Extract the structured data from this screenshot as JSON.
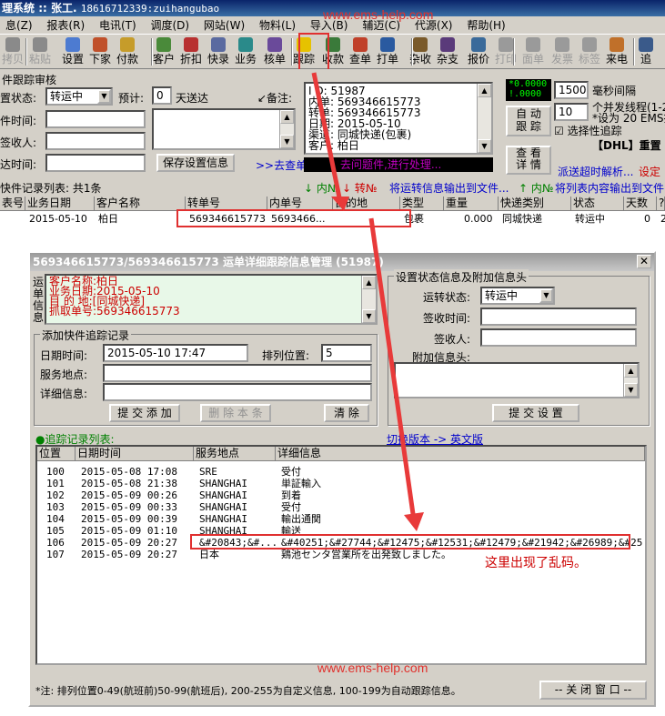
{
  "window": {
    "title": "理系统",
    "separator": "::",
    "user": "张工.",
    "account": "18616712339:zuihangubao"
  },
  "watermark": {
    "top": "www.ems-help.com",
    "bottom": "www.ems-help.com"
  },
  "menu": [
    "息(Z)",
    "报表(R)",
    "电讯(T)",
    "调度(D)",
    "网站(W)",
    "物料(L)",
    "导入(B)",
    "辅迈(C)",
    "代源(X)",
    "帮助(H)"
  ],
  "toolbar": {
    "items": [
      {
        "label": "拷贝",
        "disabled": true
      },
      {
        "label": "粘贴",
        "disabled": true
      },
      {
        "label": "设置",
        "disabled": false
      },
      {
        "label": "下家",
        "disabled": false
      },
      {
        "label": "付款",
        "disabled": false
      },
      {
        "label": "客户",
        "disabled": false
      },
      {
        "label": "折扣",
        "disabled": false
      },
      {
        "label": "快录",
        "disabled": false
      },
      {
        "label": "业务",
        "disabled": false
      },
      {
        "label": "核单",
        "disabled": false
      },
      {
        "label": "跟踪",
        "disabled": false
      },
      {
        "label": "收款",
        "disabled": false
      },
      {
        "label": "查单",
        "disabled": false
      },
      {
        "label": "打单",
        "disabled": false
      },
      {
        "label": "杂收",
        "disabled": false
      },
      {
        "label": "杂支",
        "disabled": false
      },
      {
        "label": "报价",
        "disabled": false
      },
      {
        "label": "打印",
        "disabled": true
      },
      {
        "label": "面单",
        "disabled": true
      },
      {
        "label": "发票",
        "disabled": true
      },
      {
        "label": "标签",
        "disabled": true
      },
      {
        "label": "来电",
        "disabled": false
      },
      {
        "label": "追",
        "disabled": false
      }
    ]
  },
  "tracking": {
    "section_title": "件跟踪审核",
    "status_label": "置状态:",
    "status_value": "转运中",
    "estimate_label": "预计:",
    "estimate_value": "0",
    "days_label": "天送达",
    "note_label": "↙备注:",
    "time_label": "件时间:",
    "signer_label": "签收人:",
    "arrive_label": "达时间:",
    "save_button": "保存设置信息",
    "goto_button": ">>去查单",
    "info_lines": [
      "I D: 51987",
      "内单: 569346615773",
      "转单: 569346615773",
      "日期: 2015-05-10",
      "渠道: 同城快递(包裹)",
      "客户: 柏日"
    ],
    "info_status": "去问题件,进行处理...",
    "clock1": "*0.0000",
    "clock2": "!.0000",
    "interval_value": "1500",
    "interval_label": "毫秒间隔",
    "threads_value": "10",
    "threads_label": "个并发线程(1-2",
    "threads_note": "*设为 20 EMS批",
    "auto_button": "自 动\n跟 踪",
    "selective_label": "选择性追踪",
    "dhl_label": "【DHL】重置",
    "view_button": "查 看\n详 情",
    "timeout_link": "派送超时解析...",
    "timeout_link2": "设定",
    "down_inner": "↓ 内№",
    "down_trans": "↓ 转№",
    "export_link": "将运转信息输出到文件...",
    "up_inner": "↑ 内№",
    "export_link2": "将列表内容输出到文件"
  },
  "list": {
    "count_label": "快件记录列表: 共1条",
    "headers": [
      "表号",
      "业务日期",
      "客户名称",
      "转单号",
      "内单号",
      "目的地",
      "类型",
      "重量",
      "快递类别",
      "状态",
      "天数",
      "?"
    ],
    "rows": [
      {
        "no": "",
        "date": "2015-05-10",
        "customer": "柏日",
        "trans": "569346615773",
        "inner": "5693466...",
        "dest": "",
        "type": "包裹",
        "weight": "0.000",
        "category": "同城快递",
        "status": "转运中",
        "days": "0",
        "extra": "2"
      }
    ]
  },
  "dialog": {
    "title": "569346615773/569346615773 运单详细跟踪信息管理 (51987)",
    "side_label": "运单信息",
    "info": [
      "客户名称:柏日",
      "业务日期:2015-05-10",
      "目 的 地:[同城快递]",
      "抓取单号:569346615773"
    ],
    "add_group": "添加快件追踪记录",
    "datetime_label": "日期时间:",
    "datetime_value": "2015-05-10 17:47",
    "position_label": "排列位置:",
    "position_value": "5",
    "place_label": "服务地点:",
    "detail_label": "详细信息:",
    "submit_add": "提 交 添 加",
    "delete_this": "删 除 本 条",
    "clear": "清 除",
    "status_group": "设置状态信息及附加信息头",
    "transport_label": "运转状态:",
    "transport_value": "转运中",
    "sign_time_label": "签收时间:",
    "signer_label": "签收人:",
    "extra_header_label": "附加信息头:",
    "submit_settings": "提 交 设 置",
    "records_label": "●追踪记录列表:",
    "switch_link": "切换版本 -> 英文版",
    "headers": [
      "位置",
      "日期时间",
      "服务地点",
      "详细信息"
    ],
    "records": [
      {
        "pos": "100",
        "time": "2015-05-08 17:08",
        "place": "SRE",
        "detail": "受付"
      },
      {
        "pos": "101",
        "time": "2015-05-08 21:38",
        "place": "SHANGHAI",
        "detail": "単証輸入"
      },
      {
        "pos": "102",
        "time": "2015-05-09 00:26",
        "place": "SHANGHAI",
        "detail": "到着"
      },
      {
        "pos": "103",
        "time": "2015-05-09 00:33",
        "place": "SHANGHAI",
        "detail": "受付"
      },
      {
        "pos": "104",
        "time": "2015-05-09 00:39",
        "place": "SHANGHAI",
        "detail": "輸出通関"
      },
      {
        "pos": "105",
        "time": "2015-05-09 01:10",
        "place": "SHANGHAI",
        "detail": "輸送"
      },
      {
        "pos": "106",
        "time": "2015-05-09 20:27",
        "place": "&#20843;&#...",
        "detail": "&#40251;&#27744;&#12475;&#12531;&#12479;&#21942;&#26989;&#25..."
      },
      {
        "pos": "107",
        "time": "2015-05-09 20:27",
        "place": "日本",
        "detail": "鶏池センタ営業所を出発致しました。"
      }
    ],
    "annotation": "这里出现了乱码。",
    "footnote": "*注: 排列位置0-49(航班前)50-99(航班后), 200-255为自定义信息, 100-199为自动跟踪信息。",
    "close_button": "-- 关 闭 窗 口 --"
  },
  "colors": {
    "accent_red": "#e03030",
    "link_blue": "#0000cc",
    "info_red": "#cc0000",
    "status_green": "#008000"
  }
}
